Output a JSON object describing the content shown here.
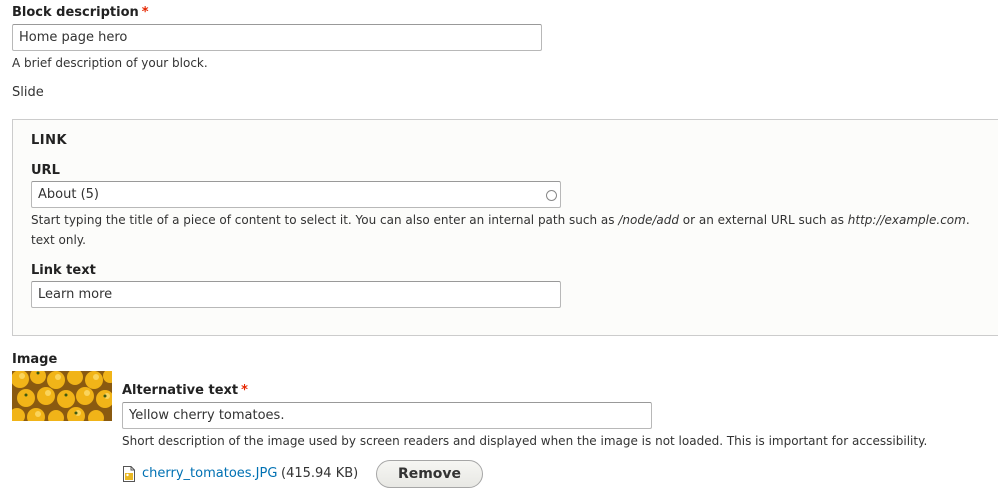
{
  "block_description": {
    "label": "Block description",
    "required_mark": "*",
    "value": "Home page hero",
    "help": "A brief description of your block."
  },
  "slide": {
    "label": "Slide"
  },
  "link": {
    "legend": "LINK",
    "url": {
      "label": "URL",
      "value": "About (5)",
      "help_prefix": "Start typing the title of a piece of content to select it. You can also enter an internal path such as ",
      "help_path": "/node/add",
      "help_middle": " or an external URL such as ",
      "help_url": "http://example.com",
      "help_suffix": ".",
      "help_line2": "text only."
    },
    "link_text": {
      "label": "Link text",
      "value": "Learn more"
    }
  },
  "image": {
    "label": "Image",
    "alt_text": {
      "label": "Alternative text",
      "required_mark": "*",
      "value": "Yellow cherry tomatoes.",
      "help": "Short description of the image used by screen readers and displayed when the image is not loaded. This is important for accessibility."
    },
    "file_name": "cherry_tomatoes.JPG",
    "file_size": "(415.94 KB)",
    "remove_label": "Remove",
    "file_icon": "image-file-icon"
  },
  "colors": {
    "required": "#e62600",
    "link": "#0071b3"
  }
}
